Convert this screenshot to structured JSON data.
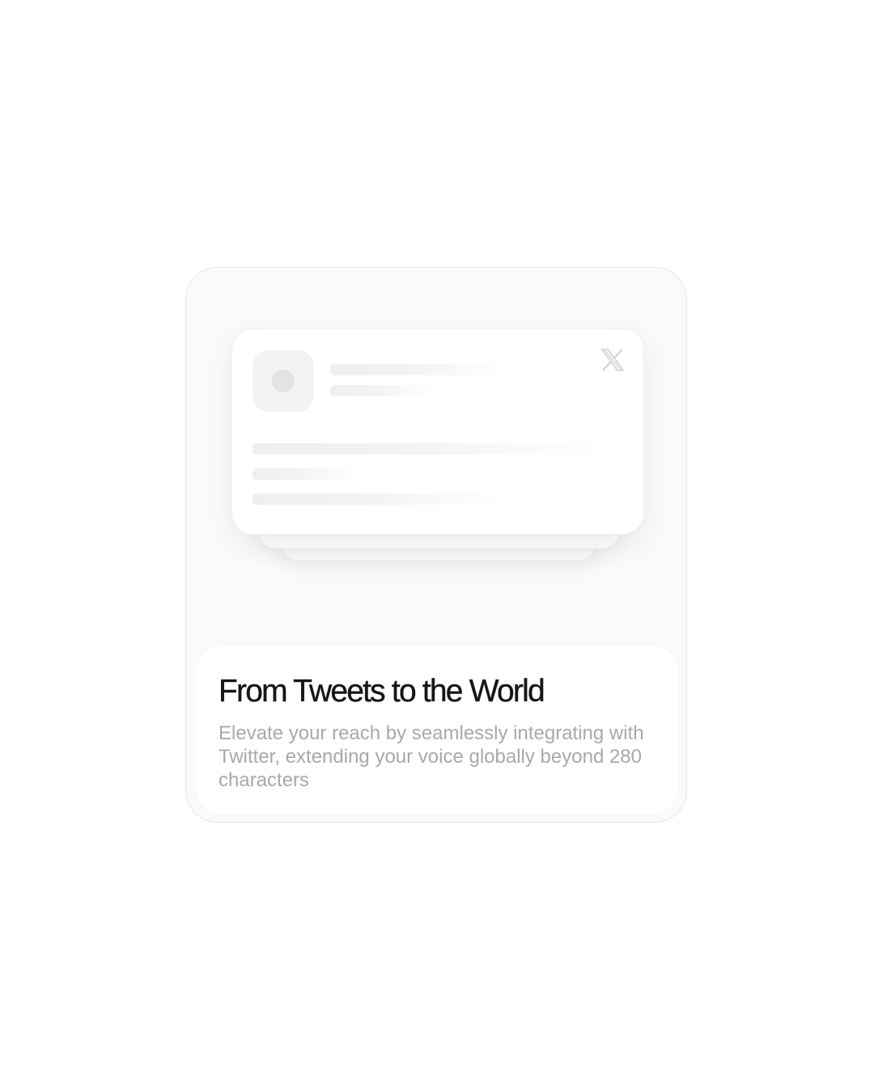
{
  "card": {
    "title": "From Tweets to the World",
    "description": "Elevate your reach by seamlessly integrating with Twitter, extending your voice globally beyond 280 characters"
  },
  "tweet_preview": {
    "brand_icon": "x-logo-icon",
    "avatar_icon": "avatar-placeholder-icon"
  },
  "colors": {
    "title": "#14161a",
    "description": "#a9a9a9",
    "card_bg": "#fafafa"
  }
}
